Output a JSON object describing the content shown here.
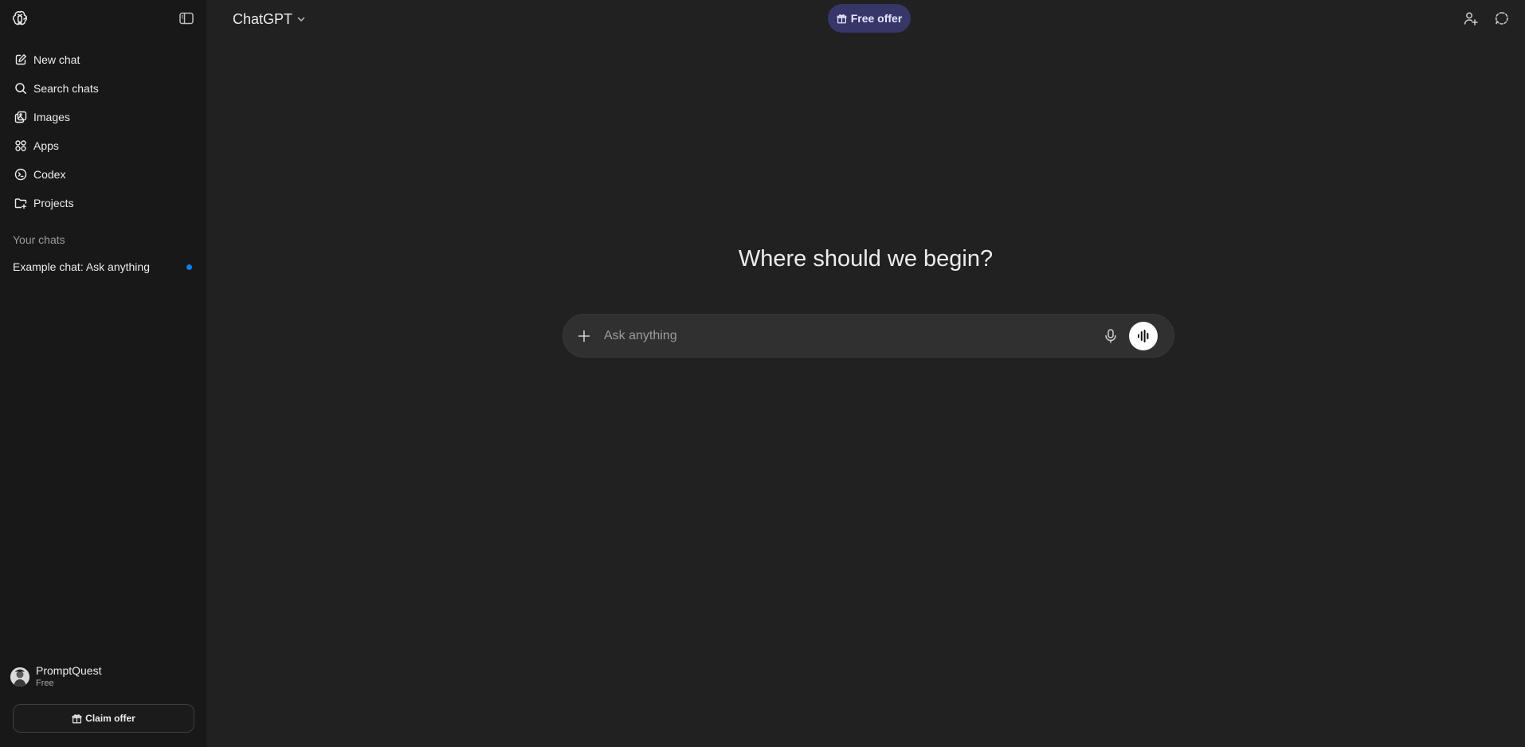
{
  "sidebar": {
    "nav": [
      {
        "label": "New chat",
        "icon": "new-chat-icon"
      },
      {
        "label": "Search chats",
        "icon": "search-icon"
      },
      {
        "label": "Images",
        "icon": "images-icon"
      },
      {
        "label": "Apps",
        "icon": "apps-icon"
      },
      {
        "label": "Codex",
        "icon": "codex-icon"
      },
      {
        "label": "Projects",
        "icon": "projects-icon"
      }
    ],
    "section_title": "Your chats",
    "chats": [
      {
        "title": "Example chat: Ask anything",
        "unread": true
      }
    ],
    "user": {
      "name": "PromptQuest",
      "plan": "Free"
    },
    "claim_label": "Claim offer"
  },
  "header": {
    "model": "ChatGPT",
    "free_offer_label": "Free offer"
  },
  "main": {
    "headline": "Where should we begin?",
    "composer": {
      "placeholder": "Ask anything"
    }
  },
  "colors": {
    "sidebar_bg": "#181818",
    "main_bg": "#212121",
    "offer_bg": "#373669",
    "unread_dot": "#0d7fe8"
  }
}
